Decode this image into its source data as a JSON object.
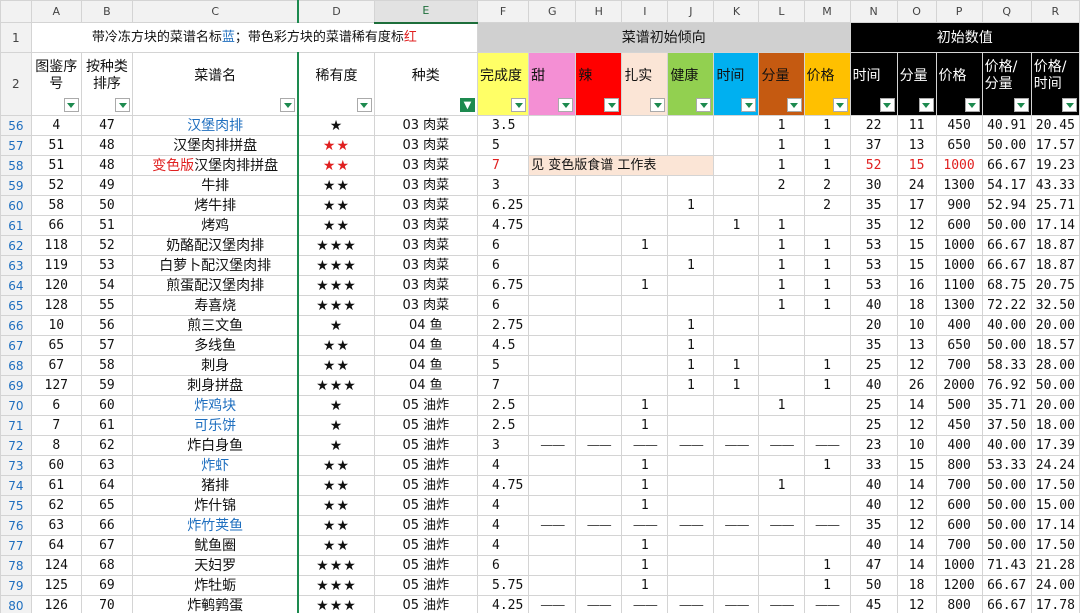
{
  "column_letters": [
    "A",
    "B",
    "C",
    "D",
    "E",
    "F",
    "G",
    "H",
    "I",
    "J",
    "K",
    "L",
    "M",
    "N",
    "O",
    "P",
    "Q",
    "R"
  ],
  "header_row_numbers": [
    "1",
    "2"
  ],
  "row1": {
    "note_prefix": "带冷冻方块的菜谱名标",
    "note_blue": "蓝",
    "note_mid": "；带色彩方块的菜谱稀有度标",
    "note_red": "红",
    "group_initial_tendency": "菜谱初始倾向",
    "group_initial_values": "初始数值"
  },
  "headers": [
    {
      "label": "图鉴序号",
      "bg": "#ffffff",
      "color": "#111111"
    },
    {
      "label": "按种类排序",
      "bg": "#ffffff",
      "color": "#111111"
    },
    {
      "label": "菜谱名",
      "bg": "#ffffff",
      "color": "#111111"
    },
    {
      "label": "稀有度",
      "bg": "#ffffff",
      "color": "#111111"
    },
    {
      "label": "种类",
      "bg": "#ffffff",
      "color": "#111111"
    },
    {
      "label": "完成度",
      "bg": "#ffff66",
      "color": "#111111"
    },
    {
      "label": "甜",
      "bg": "#f48fd4",
      "color": "#111111"
    },
    {
      "label": "辣",
      "bg": "#ff0000",
      "color": "#111111"
    },
    {
      "label": "扎实",
      "bg": "#fbe5d6",
      "color": "#111111"
    },
    {
      "label": "健康",
      "bg": "#92d050",
      "color": "#111111"
    },
    {
      "label": "时间",
      "bg": "#00b0f0",
      "color": "#111111"
    },
    {
      "label": "分量",
      "bg": "#c55a11",
      "color": "#111111"
    },
    {
      "label": "价格",
      "bg": "#ffc000",
      "color": "#111111"
    },
    {
      "label": "时间",
      "bg": "#000000",
      "color": "#ffffff"
    },
    {
      "label": "分量",
      "bg": "#000000",
      "color": "#ffffff"
    },
    {
      "label": "价格",
      "bg": "#000000",
      "color": "#ffffff"
    },
    {
      "label": "价格/分量",
      "bg": "#000000",
      "color": "#ffffff"
    },
    {
      "label": "价格/时间",
      "bg": "#000000",
      "color": "#ffffff"
    }
  ],
  "rows": [
    {
      "row": "56",
      "idx": "4",
      "ord": "47",
      "pre": "",
      "name": "汉堡肉排",
      "name_color": "blue",
      "stars": "★",
      "stars_color": "black",
      "kind": "03 肉菜",
      "done": "3.5",
      "sweet": "",
      "spicy": "",
      "solid": "",
      "healthy": "",
      "time": "",
      "portion": "1",
      "price": "1",
      "t": "22",
      "q": "11",
      "p": "450",
      "pq": "40.91",
      "pt": "20.45"
    },
    {
      "row": "57",
      "idx": "51",
      "ord": "48",
      "pre": "",
      "name": "汉堡肉排拼盘",
      "name_color": "black",
      "stars": "★★",
      "stars_color": "red",
      "kind": "03 肉菜",
      "done": "5",
      "sweet": "",
      "spicy": "",
      "solid": "",
      "healthy": "",
      "time": "",
      "portion": "1",
      "price": "1",
      "t": "37",
      "q": "13",
      "p": "650",
      "pq": "50.00",
      "pt": "17.57"
    },
    {
      "row": "58",
      "idx": "51",
      "ord": "48",
      "pre": "变色版",
      "name": "汉堡肉排拼盘",
      "name_color": "black",
      "stars": "★★",
      "stars_color": "red",
      "kind": "03 肉菜",
      "done": "7",
      "done_red": true,
      "merged_note": "见 变色版食谱 工作表",
      "portion": "1",
      "price": "1",
      "t": "52",
      "q": "15",
      "p": "1000",
      "vals_red": true,
      "pq": "66.67",
      "pt": "19.23"
    },
    {
      "row": "59",
      "idx": "52",
      "ord": "49",
      "pre": "",
      "name": "牛排",
      "name_color": "black",
      "stars": "★★",
      "stars_color": "black",
      "kind": "03 肉菜",
      "done": "3",
      "sweet": "",
      "spicy": "",
      "solid": "",
      "healthy": "",
      "time": "",
      "portion": "2",
      "price": "2",
      "t": "30",
      "q": "24",
      "p": "1300",
      "pq": "54.17",
      "pt": "43.33"
    },
    {
      "row": "60",
      "idx": "58",
      "ord": "50",
      "pre": "",
      "name": "烤牛排",
      "name_color": "black",
      "stars": "★★",
      "stars_color": "black",
      "kind": "03 肉菜",
      "done": "6.25",
      "sweet": "",
      "spicy": "",
      "solid": "",
      "healthy": "1",
      "time": "",
      "portion": "",
      "price": "2",
      "t": "35",
      "q": "17",
      "p": "900",
      "pq": "52.94",
      "pt": "25.71"
    },
    {
      "row": "61",
      "idx": "66",
      "ord": "51",
      "pre": "",
      "name": "烤鸡",
      "name_color": "black",
      "stars": "★★",
      "stars_color": "black",
      "kind": "03 肉菜",
      "done": "4.75",
      "sweet": "",
      "spicy": "",
      "solid": "",
      "healthy": "",
      "time": "1",
      "portion": "1",
      "price": "",
      "t": "35",
      "q": "12",
      "p": "600",
      "pq": "50.00",
      "pt": "17.14"
    },
    {
      "row": "62",
      "idx": "118",
      "ord": "52",
      "pre": "",
      "name": "奶酪配汉堡肉排",
      "name_color": "black",
      "stars": "★★★",
      "stars_color": "black",
      "kind": "03 肉菜",
      "done": "6",
      "sweet": "",
      "spicy": "",
      "solid": "1",
      "healthy": "",
      "time": "",
      "portion": "1",
      "price": "1",
      "t": "53",
      "q": "15",
      "p": "1000",
      "pq": "66.67",
      "pt": "18.87"
    },
    {
      "row": "63",
      "idx": "119",
      "ord": "53",
      "pre": "",
      "name": "白萝卜配汉堡肉排",
      "name_color": "black",
      "stars": "★★★",
      "stars_color": "black",
      "kind": "03 肉菜",
      "done": "6",
      "sweet": "",
      "spicy": "",
      "solid": "",
      "healthy": "1",
      "time": "",
      "portion": "1",
      "price": "1",
      "t": "53",
      "q": "15",
      "p": "1000",
      "pq": "66.67",
      "pt": "18.87"
    },
    {
      "row": "64",
      "idx": "120",
      "ord": "54",
      "pre": "",
      "name": "煎蛋配汉堡肉排",
      "name_color": "black",
      "stars": "★★★",
      "stars_color": "black",
      "kind": "03 肉菜",
      "done": "6.75",
      "sweet": "",
      "spicy": "",
      "solid": "1",
      "healthy": "",
      "time": "",
      "portion": "1",
      "price": "1",
      "t": "53",
      "q": "16",
      "p": "1100",
      "pq": "68.75",
      "pt": "20.75"
    },
    {
      "row": "65",
      "idx": "128",
      "ord": "55",
      "pre": "",
      "name": "寿喜烧",
      "name_color": "black",
      "stars": "★★★",
      "stars_color": "black",
      "kind": "03 肉菜",
      "done": "6",
      "sweet": "",
      "spicy": "",
      "solid": "",
      "healthy": "",
      "time": "",
      "portion": "1",
      "price": "1",
      "t": "40",
      "q": "18",
      "p": "1300",
      "pq": "72.22",
      "pt": "32.50"
    },
    {
      "row": "66",
      "idx": "10",
      "ord": "56",
      "pre": "",
      "name": "煎三文鱼",
      "name_color": "black",
      "stars": "★",
      "stars_color": "black",
      "kind": "04 鱼",
      "done": "2.75",
      "sweet": "",
      "spicy": "",
      "solid": "",
      "healthy": "1",
      "time": "",
      "portion": "",
      "price": "",
      "t": "20",
      "q": "10",
      "p": "400",
      "pq": "40.00",
      "pt": "20.00"
    },
    {
      "row": "67",
      "idx": "65",
      "ord": "57",
      "pre": "",
      "name": "多线鱼",
      "name_color": "black",
      "stars": "★★",
      "stars_color": "black",
      "kind": "04 鱼",
      "done": "4.5",
      "sweet": "",
      "spicy": "",
      "solid": "",
      "healthy": "1",
      "time": "",
      "portion": "",
      "price": "",
      "t": "35",
      "q": "13",
      "p": "650",
      "pq": "50.00",
      "pt": "18.57"
    },
    {
      "row": "68",
      "idx": "67",
      "ord": "58",
      "pre": "",
      "name": "刺身",
      "name_color": "black",
      "stars": "★★",
      "stars_color": "black",
      "kind": "04 鱼",
      "done": "5",
      "sweet": "",
      "spicy": "",
      "solid": "",
      "healthy": "1",
      "time": "1",
      "portion": "",
      "price": "1",
      "t": "25",
      "q": "12",
      "p": "700",
      "pq": "58.33",
      "pt": "28.00"
    },
    {
      "row": "69",
      "idx": "127",
      "ord": "59",
      "pre": "",
      "name": "刺身拼盘",
      "name_color": "black",
      "stars": "★★★",
      "stars_color": "black",
      "kind": "04 鱼",
      "done": "7",
      "sweet": "",
      "spicy": "",
      "solid": "",
      "healthy": "1",
      "time": "1",
      "portion": "",
      "price": "1",
      "t": "40",
      "q": "26",
      "p": "2000",
      "pq": "76.92",
      "pt": "50.00"
    },
    {
      "row": "70",
      "idx": "6",
      "ord": "60",
      "pre": "",
      "name": "炸鸡块",
      "name_color": "blue",
      "stars": "★",
      "stars_color": "black",
      "kind": "05 油炸",
      "done": "2.5",
      "sweet": "",
      "spicy": "",
      "solid": "1",
      "healthy": "",
      "time": "",
      "portion": "1",
      "price": "",
      "t": "25",
      "q": "14",
      "p": "500",
      "pq": "35.71",
      "pt": "20.00"
    },
    {
      "row": "71",
      "idx": "7",
      "ord": "61",
      "pre": "",
      "name": "可乐饼",
      "name_color": "blue",
      "stars": "★",
      "stars_color": "black",
      "kind": "05 油炸",
      "done": "2.5",
      "sweet": "",
      "spicy": "",
      "solid": "1",
      "healthy": "",
      "time": "",
      "portion": "",
      "price": "",
      "t": "25",
      "q": "12",
      "p": "450",
      "pq": "37.50",
      "pt": "18.00"
    },
    {
      "row": "72",
      "idx": "8",
      "ord": "62",
      "pre": "",
      "name": "炸白身鱼",
      "name_color": "black",
      "stars": "★",
      "stars_color": "black",
      "kind": "05 油炸",
      "done": "3",
      "dashes": true,
      "t": "23",
      "q": "10",
      "p": "400",
      "pq": "40.00",
      "pt": "17.39"
    },
    {
      "row": "73",
      "idx": "60",
      "ord": "63",
      "pre": "",
      "name": "炸虾",
      "name_color": "blue",
      "stars": "★★",
      "stars_color": "black",
      "kind": "05 油炸",
      "done": "4",
      "sweet": "",
      "spicy": "",
      "solid": "1",
      "healthy": "",
      "time": "",
      "portion": "",
      "price": "1",
      "t": "33",
      "q": "15",
      "p": "800",
      "pq": "53.33",
      "pt": "24.24"
    },
    {
      "row": "74",
      "idx": "61",
      "ord": "64",
      "pre": "",
      "name": "猪排",
      "name_color": "black",
      "stars": "★★",
      "stars_color": "black",
      "kind": "05 油炸",
      "done": "4.75",
      "sweet": "",
      "spicy": "",
      "solid": "1",
      "healthy": "",
      "time": "",
      "portion": "1",
      "price": "",
      "t": "40",
      "q": "14",
      "p": "700",
      "pq": "50.00",
      "pt": "17.50"
    },
    {
      "row": "75",
      "idx": "62",
      "ord": "65",
      "pre": "",
      "name": "炸什锦",
      "name_color": "black",
      "stars": "★★",
      "stars_color": "black",
      "kind": "05 油炸",
      "done": "4",
      "sweet": "",
      "spicy": "",
      "solid": "1",
      "healthy": "",
      "time": "",
      "portion": "",
      "price": "",
      "t": "40",
      "q": "12",
      "p": "600",
      "pq": "50.00",
      "pt": "15.00"
    },
    {
      "row": "76",
      "idx": "63",
      "ord": "66",
      "pre": "",
      "name": "炸竹荚鱼",
      "name_color": "blue",
      "stars": "★★",
      "stars_color": "black",
      "kind": "05 油炸",
      "done": "4",
      "dashes": true,
      "t": "35",
      "q": "12",
      "p": "600",
      "pq": "50.00",
      "pt": "17.14"
    },
    {
      "row": "77",
      "idx": "64",
      "ord": "67",
      "pre": "",
      "name": "鱿鱼圈",
      "name_color": "black",
      "stars": "★★",
      "stars_color": "black",
      "kind": "05 油炸",
      "done": "4",
      "sweet": "",
      "spicy": "",
      "solid": "1",
      "healthy": "",
      "time": "",
      "portion": "",
      "price": "",
      "t": "40",
      "q": "14",
      "p": "700",
      "pq": "50.00",
      "pt": "17.50"
    },
    {
      "row": "78",
      "idx": "124",
      "ord": "68",
      "pre": "",
      "name": "天妇罗",
      "name_color": "black",
      "stars": "★★★",
      "stars_color": "black",
      "kind": "05 油炸",
      "done": "6",
      "sweet": "",
      "spicy": "",
      "solid": "1",
      "healthy": "",
      "time": "",
      "portion": "",
      "price": "1",
      "t": "47",
      "q": "14",
      "p": "1000",
      "pq": "71.43",
      "pt": "21.28"
    },
    {
      "row": "79",
      "idx": "125",
      "ord": "69",
      "pre": "",
      "name": "炸牡蛎",
      "name_color": "black",
      "stars": "★★★",
      "stars_color": "black",
      "kind": "05 油炸",
      "done": "5.75",
      "sweet": "",
      "spicy": "",
      "solid": "1",
      "healthy": "",
      "time": "",
      "portion": "",
      "price": "1",
      "t": "50",
      "q": "18",
      "p": "1200",
      "pq": "66.67",
      "pt": "24.00"
    },
    {
      "row": "80",
      "idx": "126",
      "ord": "70",
      "pre": "",
      "name": "炸鹌鹑蛋",
      "name_color": "black",
      "stars": "★★★",
      "stars_color": "black",
      "kind": "05 油炸",
      "done": "4.25",
      "dashes": true,
      "t": "45",
      "q": "12",
      "p": "800",
      "pq": "66.67",
      "pt": "17.78"
    }
  ],
  "dash_text": "——"
}
